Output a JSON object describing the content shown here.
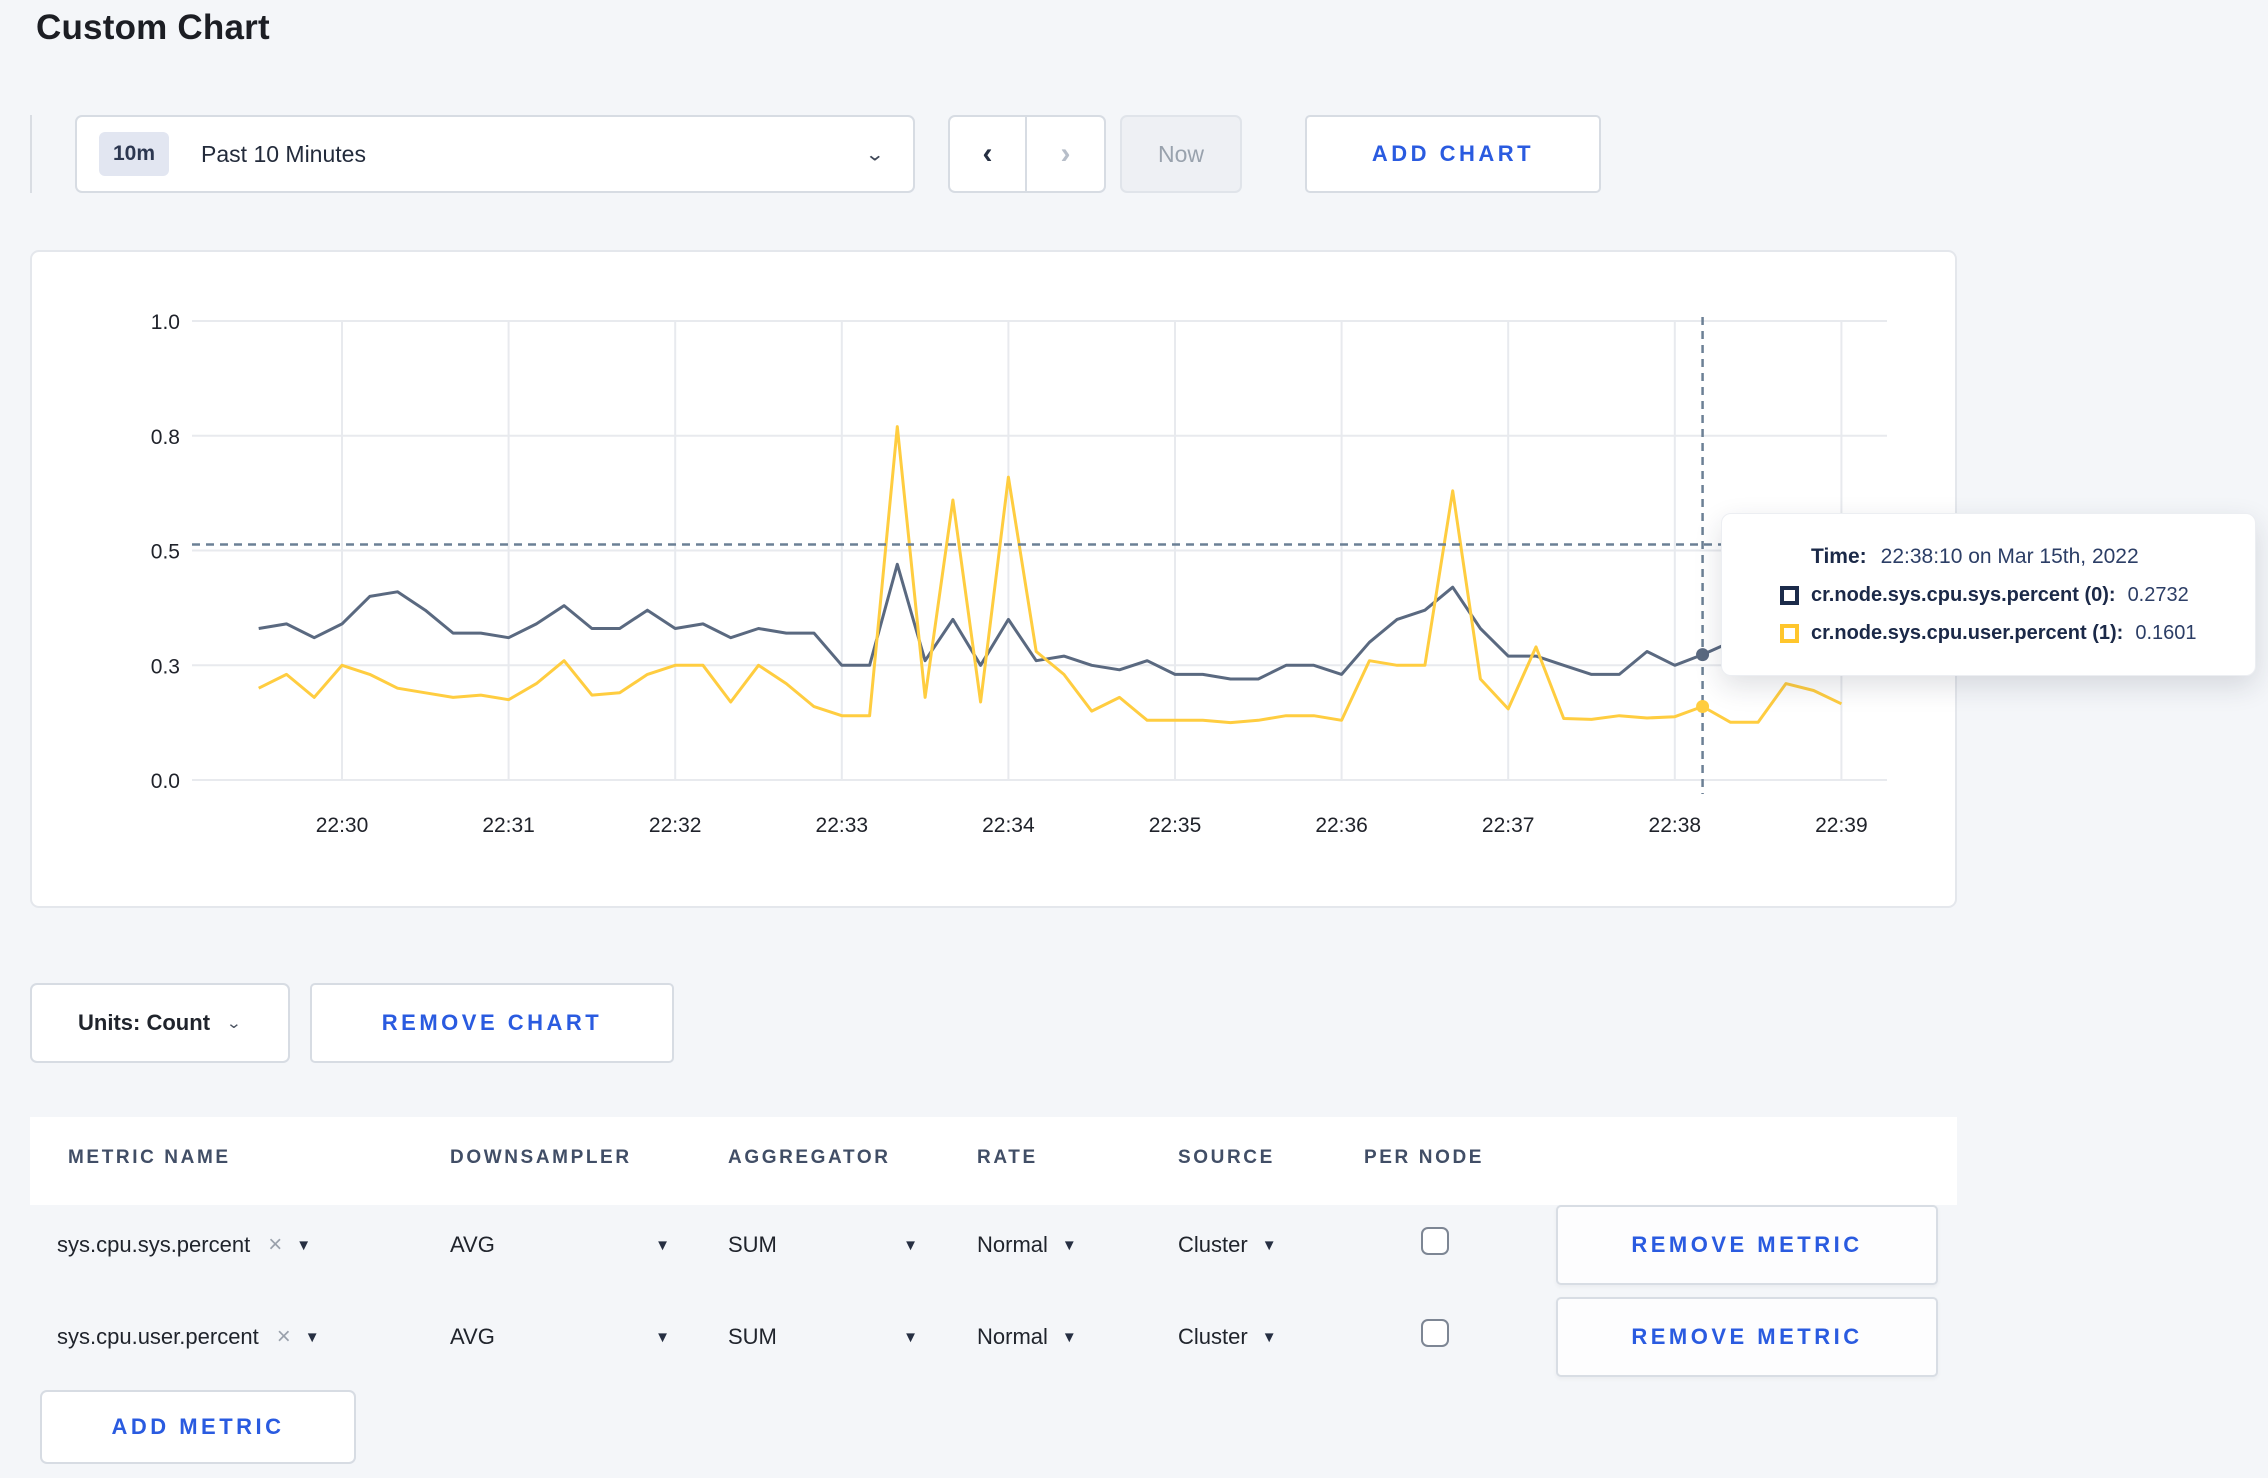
{
  "page": {
    "title": "Custom Chart"
  },
  "toolbar": {
    "range_badge": "10m",
    "range_label": "Past 10 Minutes",
    "prev_icon": "‹",
    "next_icon": "›",
    "now_label": "Now",
    "add_chart_label": "ADD CHART"
  },
  "chart_footer": {
    "units_label": "Units: Count",
    "remove_chart_label": "REMOVE CHART"
  },
  "tooltip": {
    "time_label": "Time:",
    "time_value": "22:38:10 on Mar 15th, 2022",
    "rows": [
      {
        "label": "cr.node.sys.cpu.sys.percent (0):",
        "value": "0.2732",
        "swatch_color": "#1c2b4a"
      },
      {
        "label": "cr.node.sys.cpu.user.percent (1):",
        "value": "0.1601",
        "swatch_color": "#ffc62c"
      }
    ]
  },
  "table": {
    "headers": [
      "METRIC NAME",
      "DOWNSAMPLER",
      "AGGREGATOR",
      "RATE",
      "SOURCE",
      "PER NODE"
    ],
    "rows": [
      {
        "metric": "sys.cpu.sys.percent",
        "clear_icon": "×",
        "downsampler": "AVG",
        "aggregator": "SUM",
        "rate": "Normal",
        "source": "Cluster",
        "per_node_checked": false,
        "remove_label": "REMOVE METRIC"
      },
      {
        "metric": "sys.cpu.user.percent",
        "clear_icon": "×",
        "downsampler": "AVG",
        "aggregator": "SUM",
        "rate": "Normal",
        "source": "Cluster",
        "per_node_checked": false,
        "remove_label": "REMOVE METRIC"
      }
    ],
    "add_metric_label": "ADD METRIC"
  },
  "chart_data": {
    "type": "line",
    "x_axis": "time",
    "x_tick_labels": [
      "22:30",
      "22:31",
      "22:32",
      "22:33",
      "22:34",
      "22:35",
      "22:36",
      "22:37",
      "22:38",
      "22:39"
    ],
    "y_ticks": [
      {
        "value": 0.0,
        "label": "0.0"
      },
      {
        "value": 0.25,
        "label": "0.3"
      },
      {
        "value": 0.5,
        "label": "0.5"
      },
      {
        "value": 0.75,
        "label": "0.8"
      },
      {
        "value": 1.0,
        "label": "1.0"
      }
    ],
    "ylim": [
      0,
      1
    ],
    "grid": true,
    "point_interval_seconds": 10,
    "start_time": "22:29:30",
    "end_time": "22:39:00",
    "series": [
      {
        "name": "cr.node.sys.cpu.sys.percent",
        "color": "#5a6980",
        "values": [
          0.33,
          0.34,
          0.31,
          0.34,
          0.4,
          0.41,
          0.37,
          0.32,
          0.32,
          0.31,
          0.34,
          0.38,
          0.33,
          0.33,
          0.37,
          0.33,
          0.34,
          0.31,
          0.33,
          0.32,
          0.32,
          0.25,
          0.25,
          0.47,
          0.26,
          0.35,
          0.25,
          0.35,
          0.26,
          0.27,
          0.25,
          0.24,
          0.26,
          0.23,
          0.23,
          0.22,
          0.22,
          0.25,
          0.25,
          0.23,
          0.3,
          0.35,
          0.37,
          0.42,
          0.33,
          0.27,
          0.27,
          0.25,
          0.23,
          0.23,
          0.28,
          0.25,
          0.2732,
          0.3,
          0.29,
          0.3,
          0.31,
          0.3
        ]
      },
      {
        "name": "cr.node.sys.cpu.user.percent",
        "color": "#ffcd40",
        "values": [
          0.2,
          0.23,
          0.18,
          0.25,
          0.23,
          0.2,
          0.19,
          0.18,
          0.185,
          0.175,
          0.21,
          0.26,
          0.185,
          0.19,
          0.23,
          0.25,
          0.25,
          0.17,
          0.25,
          0.21,
          0.16,
          0.14,
          0.14,
          0.77,
          0.18,
          0.61,
          0.17,
          0.66,
          0.28,
          0.23,
          0.15,
          0.18,
          0.13,
          0.13,
          0.13,
          0.125,
          0.13,
          0.14,
          0.14,
          0.13,
          0.26,
          0.25,
          0.25,
          0.63,
          0.22,
          0.155,
          0.29,
          0.134,
          0.132,
          0.14,
          0.135,
          0.138,
          0.1601,
          0.126,
          0.126,
          0.21,
          0.195,
          0.166
        ]
      }
    ],
    "crosshair": {
      "time": "22:38:10",
      "x_minutes_after_22_30": 8.1667,
      "y_value": 0.513
    },
    "hover_points": [
      {
        "series": 0,
        "time": "22:38:10",
        "value": 0.2732
      },
      {
        "series": 1,
        "time": "22:38:10",
        "value": 0.1601
      }
    ],
    "grid_color": "#e8eaee",
    "crosshair_color": "#6c8095",
    "tick_label_color": "#20232b"
  }
}
